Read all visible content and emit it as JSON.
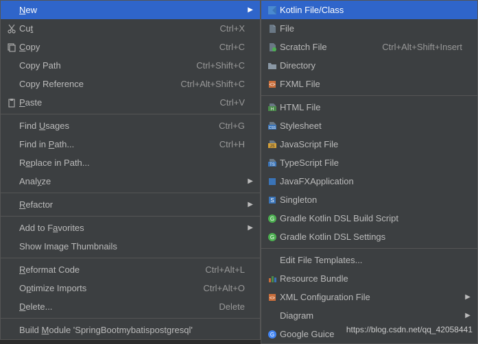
{
  "leftMenu": [
    {
      "type": "item",
      "icon": "",
      "label": "New",
      "shortcut": "",
      "arrow": true,
      "highlighted": true,
      "u": 0
    },
    {
      "type": "item",
      "icon": "cut",
      "label": "Cut",
      "shortcut": "Ctrl+X",
      "u": 2
    },
    {
      "type": "item",
      "icon": "copy",
      "label": "Copy",
      "shortcut": "Ctrl+C",
      "u": 0
    },
    {
      "type": "item",
      "icon": "",
      "label": "Copy Path",
      "shortcut": "Ctrl+Shift+C"
    },
    {
      "type": "item",
      "icon": "",
      "label": "Copy Reference",
      "shortcut": "Ctrl+Alt+Shift+C"
    },
    {
      "type": "item",
      "icon": "paste",
      "label": "Paste",
      "shortcut": "Ctrl+V",
      "u": 0
    },
    {
      "type": "sep"
    },
    {
      "type": "item",
      "icon": "",
      "label": "Find Usages",
      "shortcut": "Ctrl+G",
      "u": 5
    },
    {
      "type": "item",
      "icon": "",
      "label": "Find in Path...",
      "shortcut": "Ctrl+H",
      "u": 8
    },
    {
      "type": "item",
      "icon": "",
      "label": "Replace in Path...",
      "shortcut": "",
      "u": 1
    },
    {
      "type": "item",
      "icon": "",
      "label": "Analyze",
      "arrow": true,
      "u": 4
    },
    {
      "type": "sep"
    },
    {
      "type": "item",
      "icon": "",
      "label": "Refactor",
      "arrow": true,
      "u": 0
    },
    {
      "type": "sep"
    },
    {
      "type": "item",
      "icon": "",
      "label": "Add to Favorites",
      "arrow": true,
      "u": 8
    },
    {
      "type": "item",
      "icon": "",
      "label": "Show Image Thumbnails"
    },
    {
      "type": "sep"
    },
    {
      "type": "item",
      "icon": "",
      "label": "Reformat Code",
      "shortcut": "Ctrl+Alt+L",
      "u": 0
    },
    {
      "type": "item",
      "icon": "",
      "label": "Optimize Imports",
      "shortcut": "Ctrl+Alt+O",
      "u": 1
    },
    {
      "type": "item",
      "icon": "",
      "label": "Delete...",
      "shortcut": "Delete",
      "u": 0
    },
    {
      "type": "sep"
    },
    {
      "type": "item",
      "icon": "",
      "label": "Build Module 'SpringBootmybatispostgresql'",
      "u": 6
    }
  ],
  "rightMenu": [
    {
      "type": "item",
      "icon": "kotlin",
      "label": "Kotlin File/Class",
      "highlighted": true
    },
    {
      "type": "item",
      "icon": "file",
      "label": "File"
    },
    {
      "type": "item",
      "icon": "scratch",
      "label": "Scratch File",
      "shortcut": "Ctrl+Alt+Shift+Insert"
    },
    {
      "type": "item",
      "icon": "folder",
      "label": "Directory"
    },
    {
      "type": "item",
      "icon": "fxml",
      "label": "FXML File"
    },
    {
      "type": "sep"
    },
    {
      "type": "item",
      "icon": "html",
      "label": "HTML File"
    },
    {
      "type": "item",
      "icon": "css",
      "label": "Stylesheet"
    },
    {
      "type": "item",
      "icon": "js",
      "label": "JavaScript File"
    },
    {
      "type": "item",
      "icon": "ts",
      "label": "TypeScript File"
    },
    {
      "type": "item",
      "icon": "jfx",
      "label": "JavaFXApplication"
    },
    {
      "type": "item",
      "icon": "singleton",
      "label": "Singleton"
    },
    {
      "type": "item",
      "icon": "gradle",
      "label": "Gradle Kotlin DSL Build Script"
    },
    {
      "type": "item",
      "icon": "gradle",
      "label": "Gradle Kotlin DSL Settings"
    },
    {
      "type": "sep"
    },
    {
      "type": "item",
      "icon": "",
      "label": "Edit File Templates..."
    },
    {
      "type": "item",
      "icon": "resource",
      "label": "Resource Bundle"
    },
    {
      "type": "item",
      "icon": "xml",
      "label": "XML Configuration File",
      "arrow": true
    },
    {
      "type": "item",
      "icon": "",
      "label": "Diagram",
      "arrow": true
    },
    {
      "type": "item",
      "icon": "google",
      "label": "Google Guice"
    }
  ],
  "watermark": "https://blog.csdn.net/qq_42058441"
}
